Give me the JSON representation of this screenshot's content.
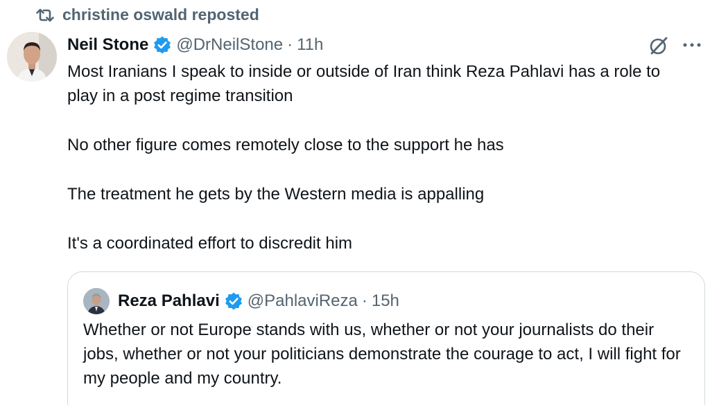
{
  "repost": {
    "text": "christine oswald reposted",
    "icon": "repost-icon"
  },
  "post": {
    "author_name": "Neil Stone",
    "handle": "@DrNeilStone",
    "separator": "·",
    "time": "11h",
    "verified": true,
    "paragraphs": [
      "Most Iranians I speak to inside or outside of Iran think Reza Pahlavi has a role to play in a post regime transition",
      "No other figure comes remotely close to the support he has",
      "The treatment he gets by the Western media is appalling",
      "It's a coordinated effort to discredit him"
    ]
  },
  "quote": {
    "author_name": "Reza Pahlavi",
    "handle": "@PahlaviReza",
    "separator": "·",
    "time": "15h",
    "verified": true,
    "text": "Whether or not Europe stands with us, whether or not your journalists do their jobs, whether or not your politicians demonstrate the courage to act, I will fight for my people and my country."
  },
  "icons": {
    "grok": "grok-icon",
    "more": "more-options-icon",
    "verified": "verified-badge-icon"
  },
  "colors": {
    "text": "#0f1419",
    "secondary": "#536471",
    "verified_blue": "#1d9bf0",
    "border": "#cfd9de"
  }
}
